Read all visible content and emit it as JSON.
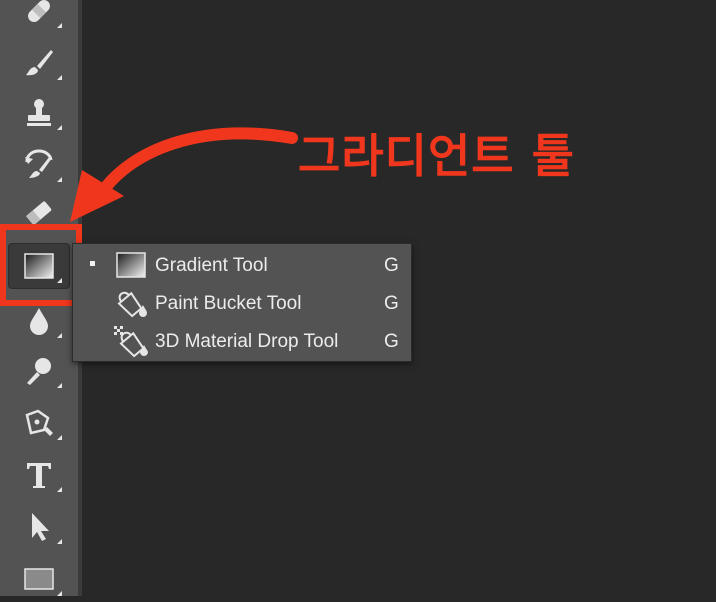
{
  "annotation": {
    "text": "그라디언트 툴",
    "color": "#f0371d"
  },
  "toolbar": {
    "tools": [
      {
        "name": "healing-brush-tool",
        "icon": "bandage-icon"
      },
      {
        "name": "brush-tool",
        "icon": "brush-icon"
      },
      {
        "name": "clone-stamp-tool",
        "icon": "stamp-icon"
      },
      {
        "name": "history-brush-tool",
        "icon": "history-brush-icon"
      },
      {
        "name": "eraser-tool",
        "icon": "eraser-icon"
      },
      {
        "name": "gradient-tool",
        "icon": "gradient-icon",
        "active": true
      },
      {
        "name": "blur-tool",
        "icon": "drop-icon"
      },
      {
        "name": "dodge-tool",
        "icon": "dodge-icon"
      },
      {
        "name": "pen-tool",
        "icon": "pen-icon"
      },
      {
        "name": "type-tool",
        "icon": "type-icon"
      },
      {
        "name": "path-selection-tool",
        "icon": "arrow-cursor-icon"
      },
      {
        "name": "rectangle-tool",
        "icon": "rectangle-icon"
      }
    ]
  },
  "flyout": {
    "items": [
      {
        "label": "Gradient Tool",
        "shortcut": "G",
        "icon": "gradient-icon",
        "selected": true
      },
      {
        "label": "Paint Bucket Tool",
        "shortcut": "G",
        "icon": "paint-bucket-icon",
        "selected": false
      },
      {
        "label": "3D Material Drop Tool",
        "shortcut": "G",
        "icon": "material-drop-icon",
        "selected": false
      }
    ]
  }
}
